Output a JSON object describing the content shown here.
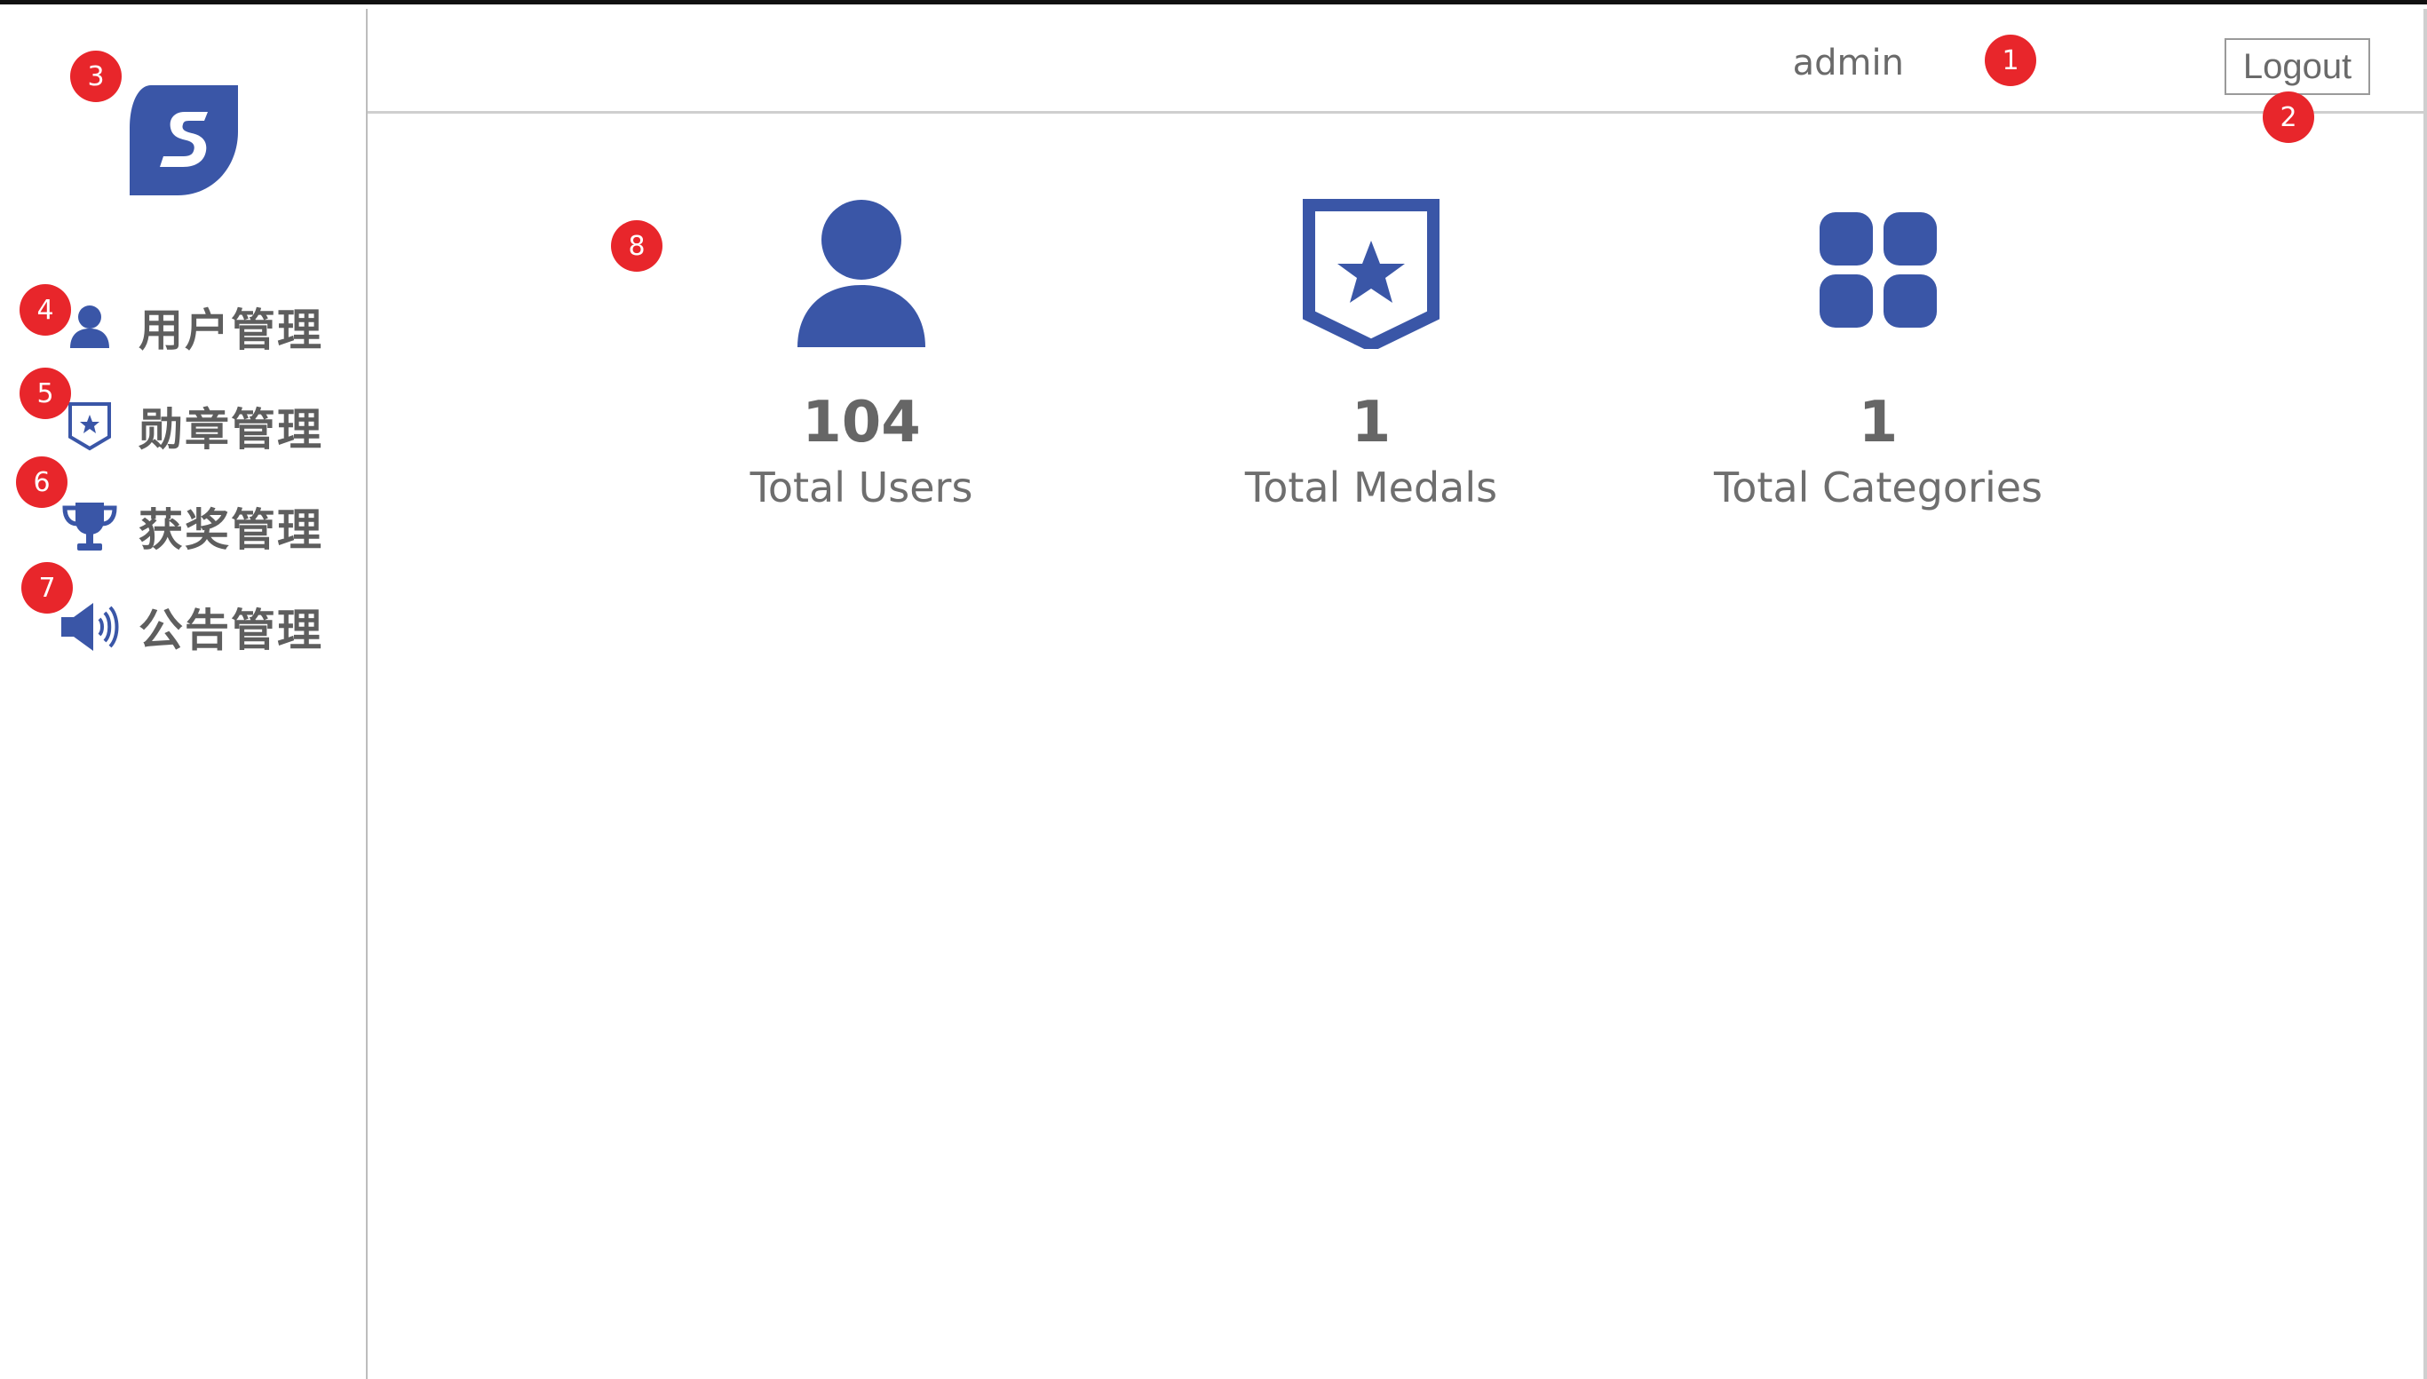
{
  "header": {
    "username": "admin",
    "logout_label": "Logout"
  },
  "sidebar": {
    "items": [
      {
        "label": "用户管理",
        "icon": "user-icon"
      },
      {
        "label": "勋章管理",
        "icon": "medal-icon"
      },
      {
        "label": "获奖管理",
        "icon": "trophy-icon"
      },
      {
        "label": "公告管理",
        "icon": "announcement-icon"
      }
    ]
  },
  "stats": [
    {
      "value": "104",
      "label": "Total Users",
      "icon": "user-icon"
    },
    {
      "value": "1",
      "label": "Total Medals",
      "icon": "medal-icon"
    },
    {
      "value": "1",
      "label": "Total Categories",
      "icon": "categories-icon"
    }
  ],
  "markers": [
    "1",
    "2",
    "3",
    "4",
    "5",
    "6",
    "7",
    "8"
  ],
  "colors": {
    "accent": "#3a56a7",
    "marker": "#e8262b",
    "text": "#666666"
  }
}
